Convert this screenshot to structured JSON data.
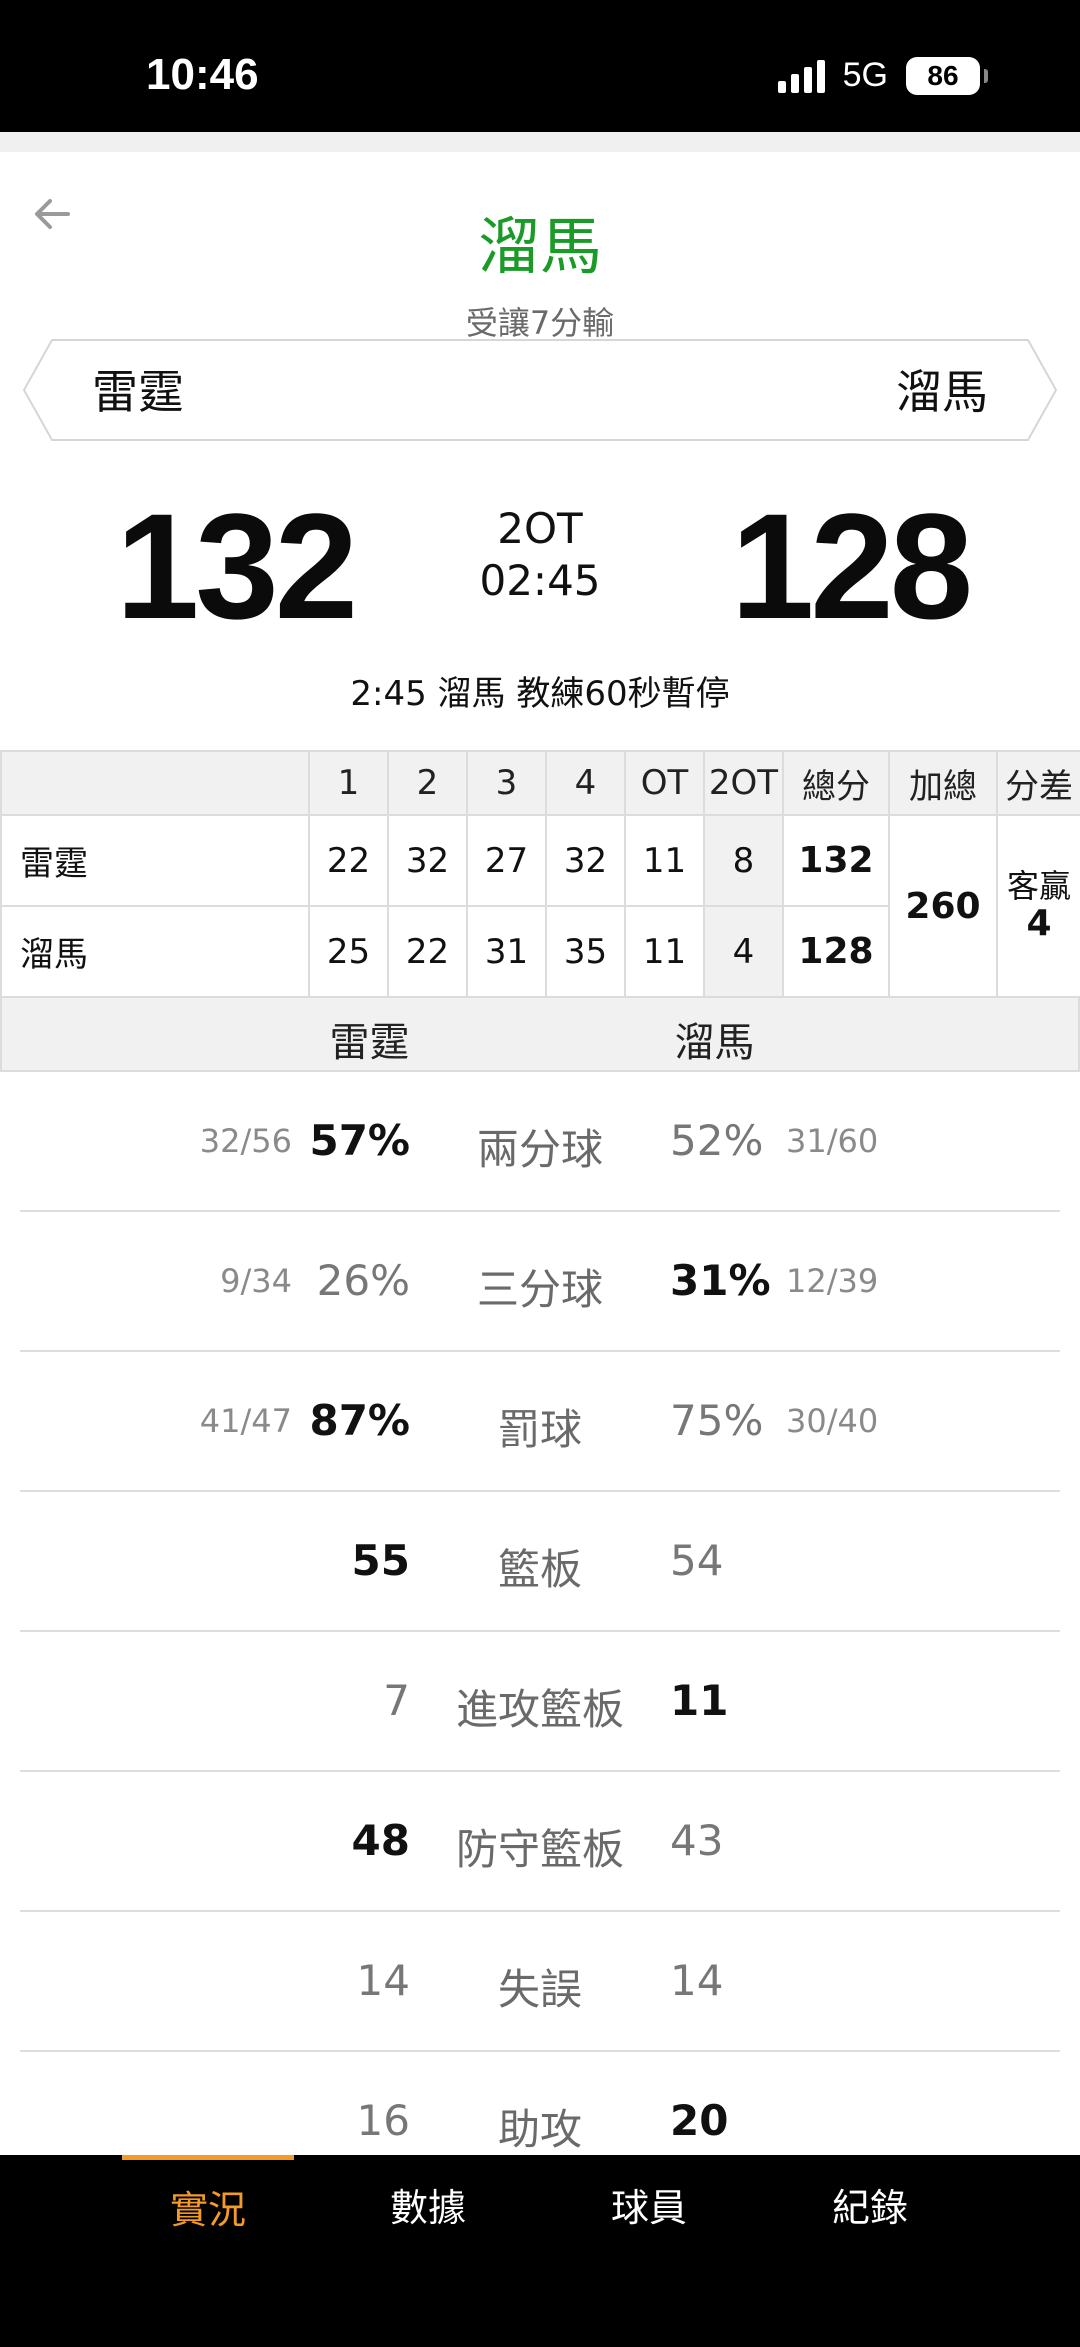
{
  "status_bar": {
    "time": "10:46",
    "network": "5G",
    "battery": "86"
  },
  "header": {
    "title": "溜馬",
    "subtitle": "受讓7分輸"
  },
  "teams": {
    "home": "雷霆",
    "away": "溜馬"
  },
  "score": {
    "home": "132",
    "away": "128",
    "period": "2OT",
    "clock": "02:45"
  },
  "last_event": "2:45 溜馬  教練60秒暫停",
  "quarter_table": {
    "headers": [
      "",
      "1",
      "2",
      "3",
      "4",
      "OT",
      "2OT",
      "總分",
      "加總",
      "分差"
    ],
    "rows": [
      {
        "team": "雷霆",
        "scores": [
          "22",
          "32",
          "27",
          "32",
          "11",
          "8"
        ],
        "total": "132"
      },
      {
        "team": "溜馬",
        "scores": [
          "25",
          "22",
          "31",
          "35",
          "11",
          "4"
        ],
        "total": "128"
      }
    ],
    "combined": "260",
    "margin_label": "客贏",
    "margin_value": "4"
  },
  "comparison": {
    "home": "雷霆",
    "away": "溜馬",
    "stats": [
      {
        "label": "兩分球",
        "home_frac": "32/56",
        "home_val": "57%",
        "away_val": "52%",
        "away_frac": "31/60",
        "leader": "home"
      },
      {
        "label": "三分球",
        "home_frac": "9/34",
        "home_val": "26%",
        "away_val": "31%",
        "away_frac": "12/39",
        "leader": "away"
      },
      {
        "label": "罰球",
        "home_frac": "41/47",
        "home_val": "87%",
        "away_val": "75%",
        "away_frac": "30/40",
        "leader": "home"
      },
      {
        "label": "籃板",
        "home_frac": "",
        "home_val": "55",
        "away_val": "54",
        "away_frac": "",
        "leader": "home"
      },
      {
        "label": "進攻籃板",
        "home_frac": "",
        "home_val": "7",
        "away_val": "11",
        "away_frac": "",
        "leader": "away"
      },
      {
        "label": "防守籃板",
        "home_frac": "",
        "home_val": "48",
        "away_val": "43",
        "away_frac": "",
        "leader": "home"
      },
      {
        "label": "失誤",
        "home_frac": "",
        "home_val": "14",
        "away_val": "14",
        "away_frac": "",
        "leader": "none"
      },
      {
        "label": "助攻",
        "home_frac": "",
        "home_val": "16",
        "away_val": "20",
        "away_frac": "",
        "leader": "away"
      }
    ]
  },
  "tabs": [
    {
      "label": "實況",
      "active": true
    },
    {
      "label": "數據",
      "active": false
    },
    {
      "label": "球員",
      "active": false
    },
    {
      "label": "紀錄",
      "active": false
    }
  ],
  "colors": {
    "title": "#1b9a27",
    "active_tab": "#f39a28"
  }
}
